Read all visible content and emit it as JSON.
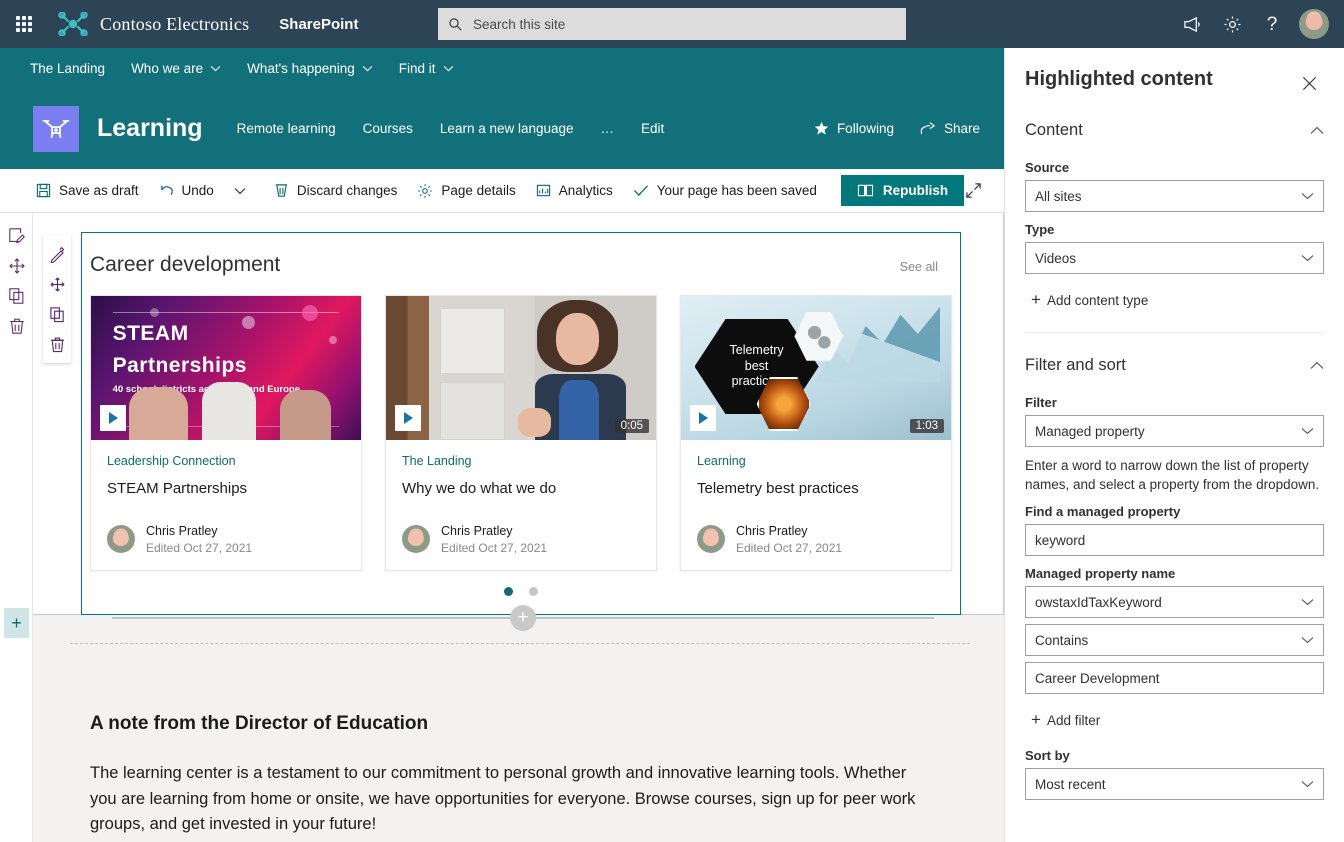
{
  "colors": {
    "suite_bar": "#2d4356",
    "site_teal": "#12707a",
    "accent_teal": "#03787c",
    "logo_tile": "#7a7ef0",
    "canvas": "#f3f2f1"
  },
  "suite_bar": {
    "waffle_icon": "app-launcher-icon",
    "org_logo_icon": "contoso-drone-logo",
    "org_name": "Contoso Electronics",
    "app_name": "SharePoint",
    "search": {
      "icon": "search-icon",
      "placeholder": "Search this site",
      "value": ""
    },
    "actions": [
      {
        "name": "feedback-icon",
        "glyph": "megaphone"
      },
      {
        "name": "settings-icon",
        "glyph": "gear"
      },
      {
        "name": "help-icon",
        "glyph": "question"
      }
    ],
    "avatar_name": "user-avatar"
  },
  "top_nav": {
    "items": [
      {
        "label": "The Landing",
        "has_chevron": false
      },
      {
        "label": "Who we are",
        "has_chevron": true
      },
      {
        "label": "What's happening",
        "has_chevron": true
      },
      {
        "label": "Find it",
        "has_chevron": true
      }
    ]
  },
  "site_header": {
    "logo_icon": "site-logo-drone",
    "title": "Learning",
    "nav": [
      {
        "label": "Remote learning"
      },
      {
        "label": "Courses"
      },
      {
        "label": "Learn a new language"
      },
      {
        "label": "…"
      },
      {
        "label": "Edit"
      }
    ],
    "following_label": "Following",
    "following_icon": "star-icon",
    "share_label": "Share",
    "share_icon": "share-icon"
  },
  "command_bar": {
    "items": [
      {
        "label": "Save as draft",
        "icon": "save-icon"
      },
      {
        "label": "Undo",
        "icon": "undo-icon"
      },
      {
        "label": "",
        "icon": "chevron-down-icon"
      },
      {
        "label": "Discard changes",
        "icon": "discard-icon"
      },
      {
        "label": "Page details",
        "icon": "page-details-icon"
      },
      {
        "label": "Analytics",
        "icon": "analytics-icon"
      }
    ],
    "status_label": "Your page has been saved",
    "status_icon": "checkmark-icon",
    "republish_label": "Republish",
    "republish_icon": "republish-icon",
    "expand_icon": "expand-icon"
  },
  "canvas_toolbars": {
    "outer": [
      {
        "name": "edit-web-part-icon"
      },
      {
        "name": "move-web-part-icon"
      },
      {
        "name": "duplicate-web-part-icon"
      },
      {
        "name": "delete-web-part-icon"
      }
    ],
    "inner": [
      {
        "name": "edit-pencil-icon"
      },
      {
        "name": "move-handle-icon"
      },
      {
        "name": "duplicate-icon"
      },
      {
        "name": "delete-icon"
      }
    ],
    "add_section_label": "+",
    "add_divider_label": "+"
  },
  "web_part": {
    "title": "Career development",
    "see_all_label": "See all",
    "cards": [
      {
        "site": "Leadership Connection",
        "name": "STEAM Partnerships",
        "author": "Chris Pratley",
        "edited": "Edited Oct 27, 2021",
        "duration": "",
        "thumb_title": "STEAM",
        "thumb_title2": "Partnerships",
        "thumb_sub": "40 school districts across US and Europe",
        "play_icon": "play-icon"
      },
      {
        "site": "The Landing",
        "name": "Why we do what we do",
        "author": "Chris Pratley",
        "edited": "Edited Oct 27, 2021",
        "duration": "0:05",
        "thumb_title": "",
        "thumb_title2": "",
        "thumb_sub": "",
        "play_icon": "play-icon"
      },
      {
        "site": "Learning",
        "name": "Telemetry best practices",
        "author": "Chris Pratley",
        "edited": "Edited Oct 27, 2021",
        "duration": "1:03",
        "thumb_title": "Telemetry",
        "thumb_title2": "best",
        "thumb_sub": "practices",
        "play_icon": "play-icon"
      }
    ],
    "pager": {
      "count": 2,
      "active_index": 0
    }
  },
  "note_section": {
    "heading": "A note from the Director of Education",
    "body": "The learning center is a testament to our commitment to personal growth and innovative learning tools. Whether you are learning from home or onsite, we have opportunities for everyone. Browse courses, sign up for peer work groups, and get invested in your future!"
  },
  "property_pane": {
    "title": "Highlighted content",
    "close_icon": "close-icon",
    "groups": [
      {
        "title": "Content",
        "expanded": true
      },
      {
        "title": "Filter and sort",
        "expanded": true
      }
    ],
    "content": {
      "source_label": "Source",
      "source_value": "All sites",
      "type_label": "Type",
      "type_value": "Videos",
      "add_content_type_label": "Add content type"
    },
    "filter": {
      "filter_label": "Filter",
      "filter_value": "Managed property",
      "helper_text": "Enter a word to narrow down the list of property names, and select a property from the dropdown.",
      "find_label": "Find a managed property",
      "find_value": "keyword",
      "prop_name_label": "Managed property name",
      "prop_name_value": "owstaxIdTaxKeyword",
      "operator_value": "Contains",
      "operand_value": "Career Development",
      "add_filter_label": "Add filter",
      "sort_label": "Sort by",
      "sort_value": "Most recent"
    }
  }
}
